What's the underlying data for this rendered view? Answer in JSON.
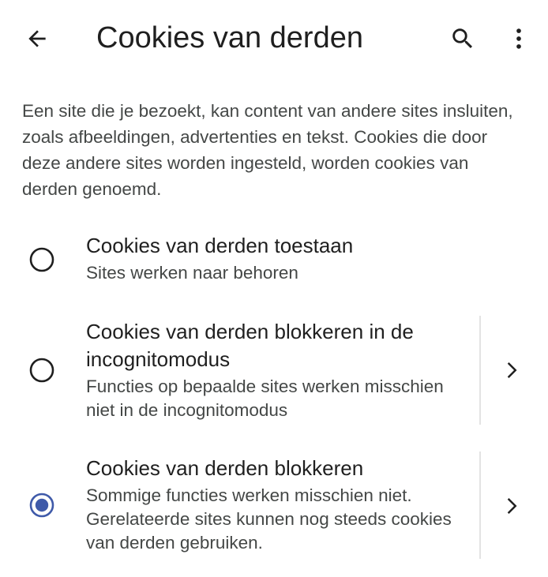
{
  "header": {
    "title": "Cookies van derden",
    "back_icon": "arrow-back-icon",
    "search_icon": "search-icon",
    "more_icon": "more-vert-icon"
  },
  "description": "Een site die je bezoekt, kan content van andere sites insluiten, zoals afbeeldingen, advertenties en tekst. Cookies die door deze andere sites worden ingesteld, worden cookies van derden genoemd.",
  "options": [
    {
      "title": "Cookies van derden toestaan",
      "subtitle": "Sites werken naar behoren",
      "selected": false,
      "has_details": false
    },
    {
      "title": "Cookies van derden blokkeren in de incognitomodus",
      "subtitle": "Functies op bepaalde sites werken misschien niet in de incognitomodus",
      "selected": false,
      "has_details": true
    },
    {
      "title": "Cookies van derden blokkeren",
      "subtitle": "Sommige functies werken misschien niet. Gerelateerde sites kunnen nog steeds cookies van derden gebruiken.",
      "selected": true,
      "has_details": true
    }
  ],
  "colors": {
    "accent": "#3f5aa9",
    "text_primary": "#1f1f1f",
    "text_secondary": "#444746",
    "radio_unselected": "#1f1f1f"
  }
}
